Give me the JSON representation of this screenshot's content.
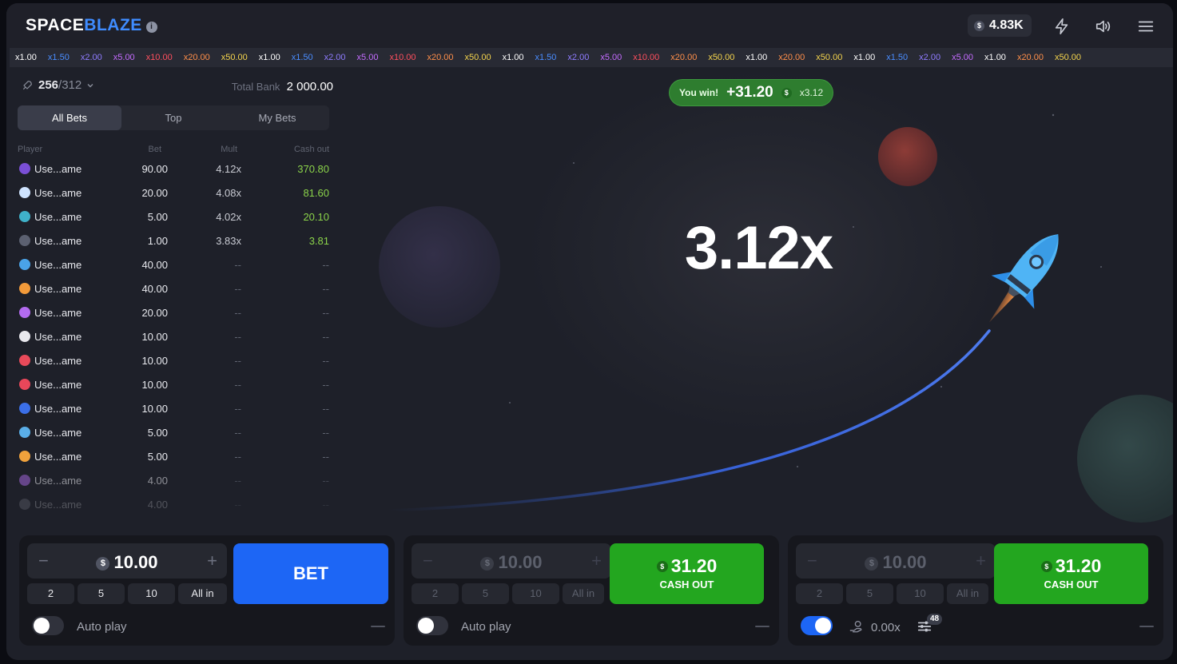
{
  "header": {
    "logo_part1": "SPACE",
    "logo_part2": "BLAZE",
    "info_icon": "i",
    "currency_symbol": "$",
    "balance": "4.83K",
    "icons": [
      "lightning-icon",
      "sound-icon",
      "menu-icon"
    ]
  },
  "history": [
    {
      "v": "x1.00",
      "c": "#ffffff"
    },
    {
      "v": "x1.50",
      "c": "#4a8dff"
    },
    {
      "v": "x2.00",
      "c": "#8f7cff"
    },
    {
      "v": "x5.00",
      "c": "#c46cff"
    },
    {
      "v": "x10.00",
      "c": "#ff4f5e"
    },
    {
      "v": "x20.00",
      "c": "#ff8f4a"
    },
    {
      "v": "x50.00",
      "c": "#f4d44d"
    },
    {
      "v": "x1.00",
      "c": "#ffffff"
    },
    {
      "v": "x1.50",
      "c": "#4a8dff"
    },
    {
      "v": "x2.00",
      "c": "#8f7cff"
    },
    {
      "v": "x5.00",
      "c": "#c46cff"
    },
    {
      "v": "x10.00",
      "c": "#ff4f5e"
    },
    {
      "v": "x20.00",
      "c": "#ff8f4a"
    },
    {
      "v": "x50.00",
      "c": "#f4d44d"
    },
    {
      "v": "x1.00",
      "c": "#ffffff"
    },
    {
      "v": "x1.50",
      "c": "#4a8dff"
    },
    {
      "v": "x2.00",
      "c": "#8f7cff"
    },
    {
      "v": "x5.00",
      "c": "#c46cff"
    },
    {
      "v": "x10.00",
      "c": "#ff4f5e"
    },
    {
      "v": "x20.00",
      "c": "#ff8f4a"
    },
    {
      "v": "x50.00",
      "c": "#f4d44d"
    },
    {
      "v": "x1.00",
      "c": "#ffffff"
    },
    {
      "v": "x20.00",
      "c": "#ff8f4a"
    },
    {
      "v": "x50.00",
      "c": "#f4d44d"
    },
    {
      "v": "x1.00",
      "c": "#ffffff"
    },
    {
      "v": "x1.50",
      "c": "#4a8dff"
    },
    {
      "v": "x2.00",
      "c": "#8f7cff"
    },
    {
      "v": "x5.00",
      "c": "#c46cff"
    },
    {
      "v": "x1.00",
      "c": "#ffffff"
    },
    {
      "v": "x20.00",
      "c": "#ff8f4a"
    },
    {
      "v": "x50.00",
      "c": "#f4d44d"
    }
  ],
  "left_panel": {
    "players_online": "256",
    "players_total": "/312",
    "total_bank_label": "Total Bank",
    "total_bank_value": "2 000.00",
    "tabs": [
      "All Bets",
      "Top",
      "My Bets"
    ],
    "active_tab": 0,
    "columns": {
      "player": "Player",
      "bet": "Bet",
      "mult": "Mult",
      "cashout": "Cash out"
    },
    "rows": [
      {
        "name": "Use...ame",
        "bet": "90.00",
        "mult": "4.12x",
        "cashout": "370.80",
        "avatar": "#7a4fd6",
        "opacity": 1
      },
      {
        "name": "Use...ame",
        "bet": "20.00",
        "mult": "4.08x",
        "cashout": "81.60",
        "avatar": "#cfe3ff",
        "opacity": 1
      },
      {
        "name": "Use...ame",
        "bet": "5.00",
        "mult": "4.02x",
        "cashout": "20.10",
        "avatar": "#3fb1c9",
        "opacity": 1
      },
      {
        "name": "Use...ame",
        "bet": "1.00",
        "mult": "3.83x",
        "cashout": "3.81",
        "avatar": "#5b6070",
        "opacity": 1
      },
      {
        "name": "Use...ame",
        "bet": "40.00",
        "mult": "--",
        "cashout": "--",
        "avatar": "#4aa3e8",
        "opacity": 1
      },
      {
        "name": "Use...ame",
        "bet": "40.00",
        "mult": "--",
        "cashout": "--",
        "avatar": "#f29a3a",
        "opacity": 1
      },
      {
        "name": "Use...ame",
        "bet": "20.00",
        "mult": "--",
        "cashout": "--",
        "avatar": "#b36bf0",
        "opacity": 1
      },
      {
        "name": "Use...ame",
        "bet": "10.00",
        "mult": "--",
        "cashout": "--",
        "avatar": "#e9e9ee",
        "opacity": 1
      },
      {
        "name": "Use...ame",
        "bet": "10.00",
        "mult": "--",
        "cashout": "--",
        "avatar": "#e84a5a",
        "opacity": 1
      },
      {
        "name": "Use...ame",
        "bet": "10.00",
        "mult": "--",
        "cashout": "--",
        "avatar": "#e8475a",
        "opacity": 1
      },
      {
        "name": "Use...ame",
        "bet": "10.00",
        "mult": "--",
        "cashout": "--",
        "avatar": "#3b6fe8",
        "opacity": 1
      },
      {
        "name": "Use...ame",
        "bet": "5.00",
        "mult": "--",
        "cashout": "--",
        "avatar": "#5aaee8",
        "opacity": 1
      },
      {
        "name": "Use...ame",
        "bet": "5.00",
        "mult": "--",
        "cashout": "--",
        "avatar": "#f0a23c",
        "opacity": 1
      },
      {
        "name": "Use...ame",
        "bet": "4.00",
        "mult": "--",
        "cashout": "--",
        "avatar": "#a064d8",
        "opacity": 0.55
      },
      {
        "name": "Use...ame",
        "bet": "4.00",
        "mult": "--",
        "cashout": "--",
        "avatar": "#8a8e9b",
        "opacity": 0.25
      }
    ]
  },
  "game": {
    "multiplier": "3.12x",
    "win_label": "You win!",
    "win_amount": "+31.20",
    "win_currency": "$",
    "win_mult": "x3.12"
  },
  "panels": [
    {
      "amount": "10.00",
      "quick": [
        "2",
        "5",
        "10",
        "All in"
      ],
      "button": "BET",
      "autoplay_label": "Auto play",
      "autoplay_on": false
    },
    {
      "amount": "10.00",
      "quick": [
        "2",
        "5",
        "10",
        "All in"
      ],
      "cashout_value": "31.20",
      "cashout_label": "CASH OUT",
      "autoplay_label": "Auto play",
      "autoplay_on": false
    },
    {
      "amount": "10.00",
      "quick": [
        "2",
        "5",
        "10",
        "All in"
      ],
      "cashout_value": "31.20",
      "cashout_label": "CASH OUT",
      "autoplay_on": true,
      "auto_cashout": "0.00x",
      "settings_badge": "48"
    }
  ]
}
